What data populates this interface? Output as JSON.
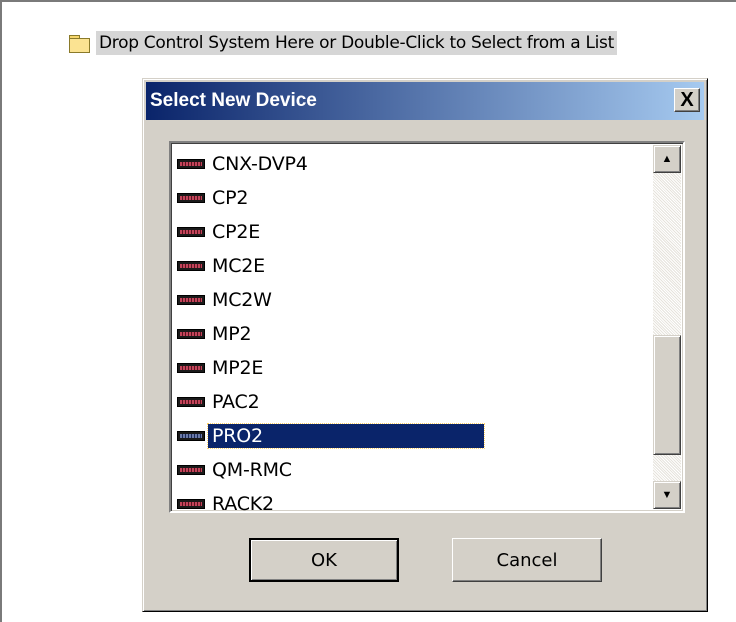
{
  "tree": {
    "drop_target_label": "Drop Control System Here or Double-Click to Select from a List",
    "icon": "folder-icon"
  },
  "dialog": {
    "title": "Select New Device",
    "close_label": "X",
    "devices": [
      {
        "label": "CNX-DVP4",
        "selected": false
      },
      {
        "label": "CP2",
        "selected": false
      },
      {
        "label": "CP2E",
        "selected": false
      },
      {
        "label": "MC2E",
        "selected": false
      },
      {
        "label": "MC2W",
        "selected": false
      },
      {
        "label": "MP2",
        "selected": false
      },
      {
        "label": "MP2E",
        "selected": false
      },
      {
        "label": "PAC2",
        "selected": false
      },
      {
        "label": "PRO2",
        "selected": true
      },
      {
        "label": "QM-RMC",
        "selected": false
      },
      {
        "label": "RACK2",
        "selected": false
      }
    ],
    "device_icon": "control-system-icon",
    "ok_label": "OK",
    "cancel_label": "Cancel",
    "colors": {
      "title_gradient_start": "#0a246a",
      "title_gradient_end": "#a6caf0",
      "selection": "#0a246a",
      "face": "#d4d0c8"
    }
  }
}
